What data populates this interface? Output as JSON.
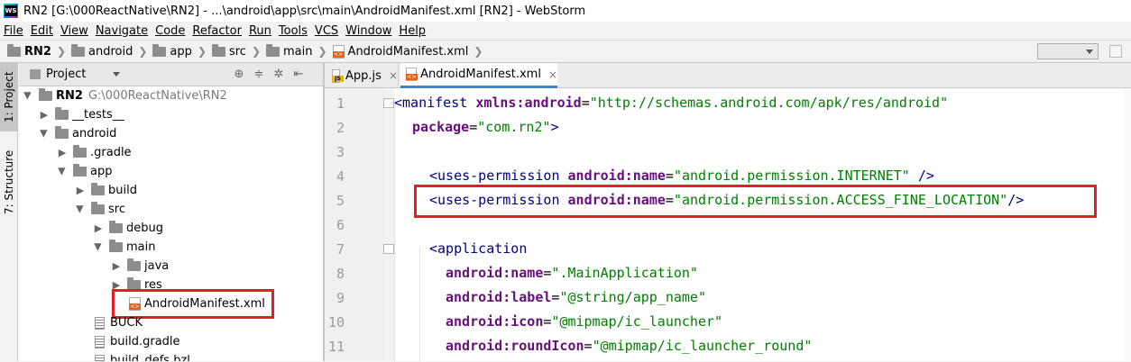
{
  "window": {
    "title": "RN2 [G:\\000ReactNative\\RN2] - ...\\android\\app\\src\\main\\AndroidManifest.xml [RN2] - WebStorm"
  },
  "menu": [
    "File",
    "Edit",
    "View",
    "Navigate",
    "Code",
    "Refactor",
    "Run",
    "Tools",
    "VCS",
    "Window",
    "Help"
  ],
  "breadcrumbs": [
    "RN2",
    "android",
    "app",
    "src",
    "main",
    "AndroidManifest.xml"
  ],
  "toolwindows": {
    "project": "1: Project",
    "structure": "7: Structure"
  },
  "project_panel": {
    "label": "Project",
    "tree": [
      {
        "name": "RN2",
        "path": "G:\\000ReactNative\\RN2"
      },
      {
        "name": "__tests__"
      },
      {
        "name": "android"
      },
      {
        "name": ".gradle"
      },
      {
        "name": "app"
      },
      {
        "name": "build"
      },
      {
        "name": "src"
      },
      {
        "name": "debug"
      },
      {
        "name": "main"
      },
      {
        "name": "java"
      },
      {
        "name": "res"
      },
      {
        "name": "AndroidManifest.xml"
      },
      {
        "name": "BUCK"
      },
      {
        "name": "build.gradle"
      },
      {
        "name": "build_defs.bzl"
      }
    ]
  },
  "tabs": [
    "App.js",
    "AndroidManifest.xml"
  ],
  "line_numbers": [
    "1",
    "2",
    "3",
    "4",
    "5",
    "6",
    "7",
    "8",
    "9",
    "10",
    "11"
  ],
  "code": {
    "l1": {
      "tag": "<manifest",
      "attr": "xmlns:android",
      "eq": "=",
      "val": "\"http://schemas.android.com/apk/res/android\""
    },
    "l2": {
      "attr": "package",
      "eq": "=",
      "val": "\"com.rn2\"",
      "end": ">"
    },
    "l4": {
      "tag": "<uses-permission",
      "attr": "android:name",
      "eq": "=",
      "val": "\"android.permission.INTERNET\"",
      "end": " />"
    },
    "l5": {
      "tag": "<uses-permission",
      "attr": "android:name",
      "eq": "=",
      "val": "\"android.permission.ACCESS_FINE_LOCATION\"",
      "end": "/>"
    },
    "l7": {
      "tag": "<application"
    },
    "l8": {
      "attr": "android:name",
      "eq": "=",
      "val": "\".MainApplication\""
    },
    "l9": {
      "attr": "android:label",
      "eq": "=",
      "val": "\"@string/app_name\""
    },
    "l10": {
      "attr": "android:icon",
      "eq": "=",
      "val": "\"@mipmap/ic_launcher\""
    },
    "l11": {
      "attr": "android:roundIcon",
      "eq": "=",
      "val": "\"@mipmap/ic_launcher_round\""
    }
  },
  "colors": {
    "tag": "#000080",
    "attribute": "#660e7a",
    "value": "#008000",
    "highlight": "#e31e24",
    "active_tab": "#4083c9"
  }
}
